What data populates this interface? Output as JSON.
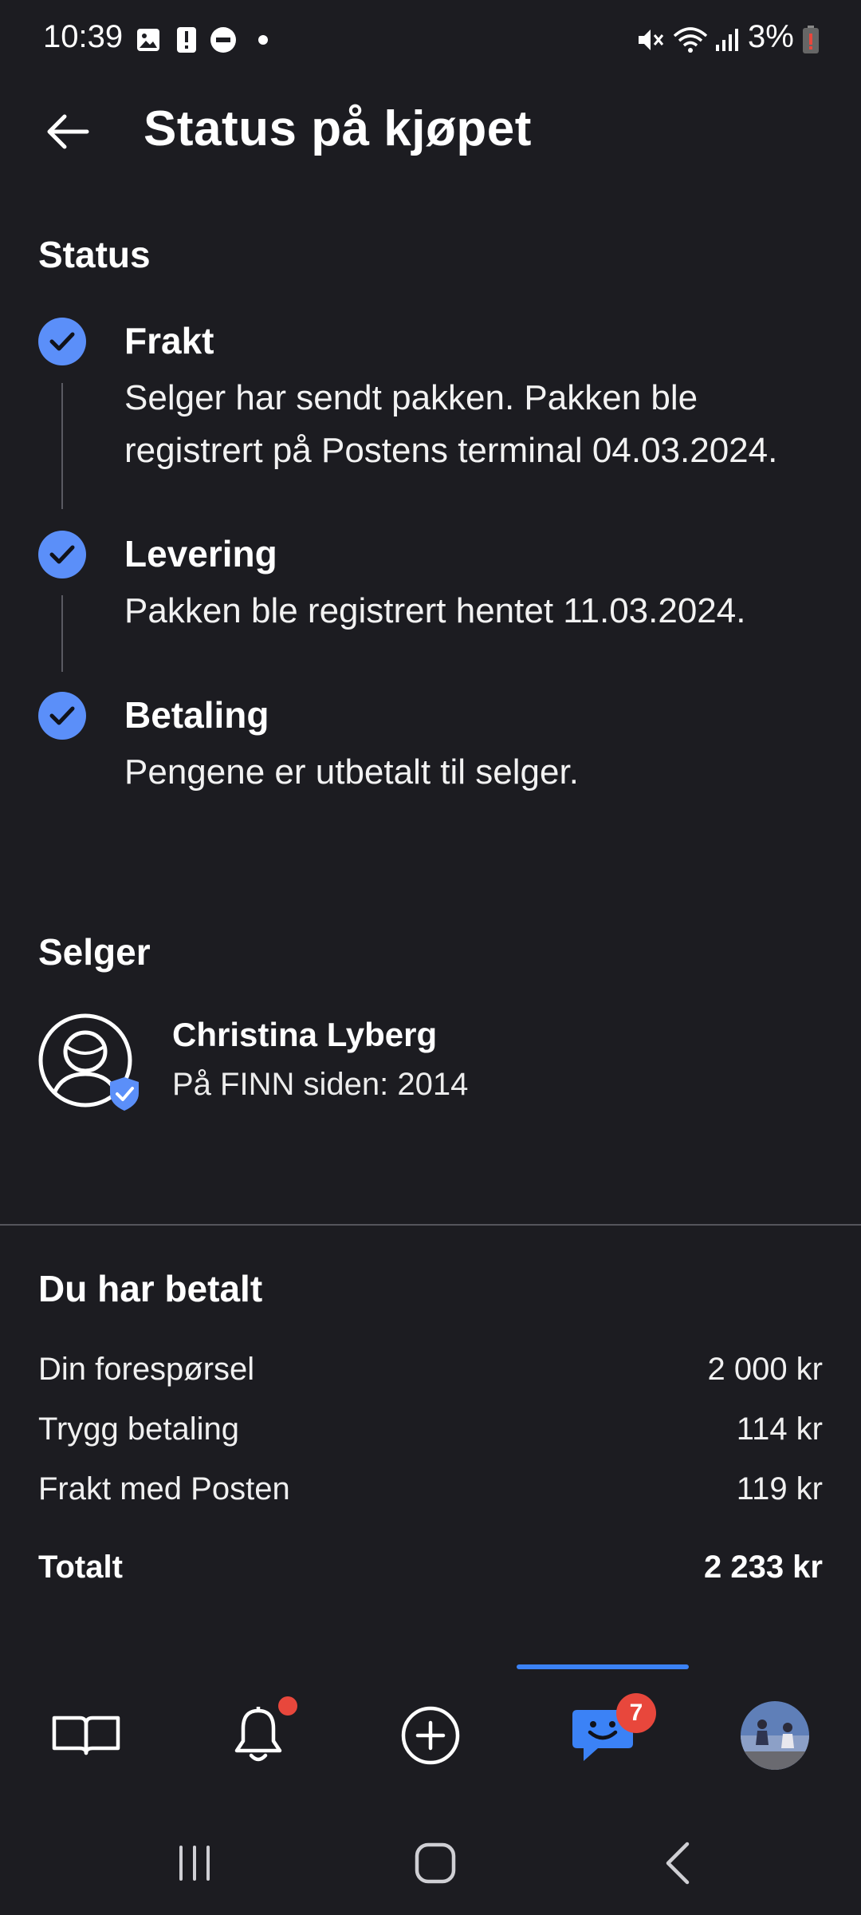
{
  "status_bar": {
    "time": "10:39",
    "battery": "3%",
    "icons": [
      "image-icon",
      "alert-icon",
      "do-not-disturb-icon",
      "dot-icon",
      "mute-icon",
      "wifi-icon",
      "signal-icon",
      "battery-icon"
    ]
  },
  "header": {
    "title": "Status på kjøpet",
    "back_icon": "arrow-left-icon"
  },
  "status": {
    "title": "Status",
    "steps": [
      {
        "title": "Frakt",
        "text_line1": "Selger har sendt pakken. Pakken ble",
        "text_line2": "registrert på Postens terminal 04.03.2024."
      },
      {
        "title": "Levering",
        "text_line1": "Pakken ble registrert hentet 11.03.2024."
      },
      {
        "title": "Betaling",
        "text_line1": "Pengene er utbetalt til selger."
      }
    ]
  },
  "seller": {
    "title": "Selger",
    "name": "Christina Lyberg",
    "since": "På FINN siden: 2014"
  },
  "payment": {
    "title": "Du har betalt",
    "rows": [
      {
        "label": "Din forespørsel",
        "value": "2 000 kr"
      },
      {
        "label": "Trygg betaling",
        "value": "114 kr"
      },
      {
        "label": "Frakt med Posten",
        "value": "119 kr"
      }
    ],
    "total_label": "Totalt",
    "total_value": "2 233 kr"
  },
  "bottom_nav": {
    "items": [
      "book-icon",
      "bell-icon",
      "add-circle-icon",
      "chat-icon",
      "profile-avatar"
    ],
    "messages_badge": "7",
    "active_index": 3
  },
  "colors": {
    "background": "#1c1c21",
    "accent": "#3b82f6",
    "check": "#5b8ff9",
    "badge": "#e8473c"
  }
}
